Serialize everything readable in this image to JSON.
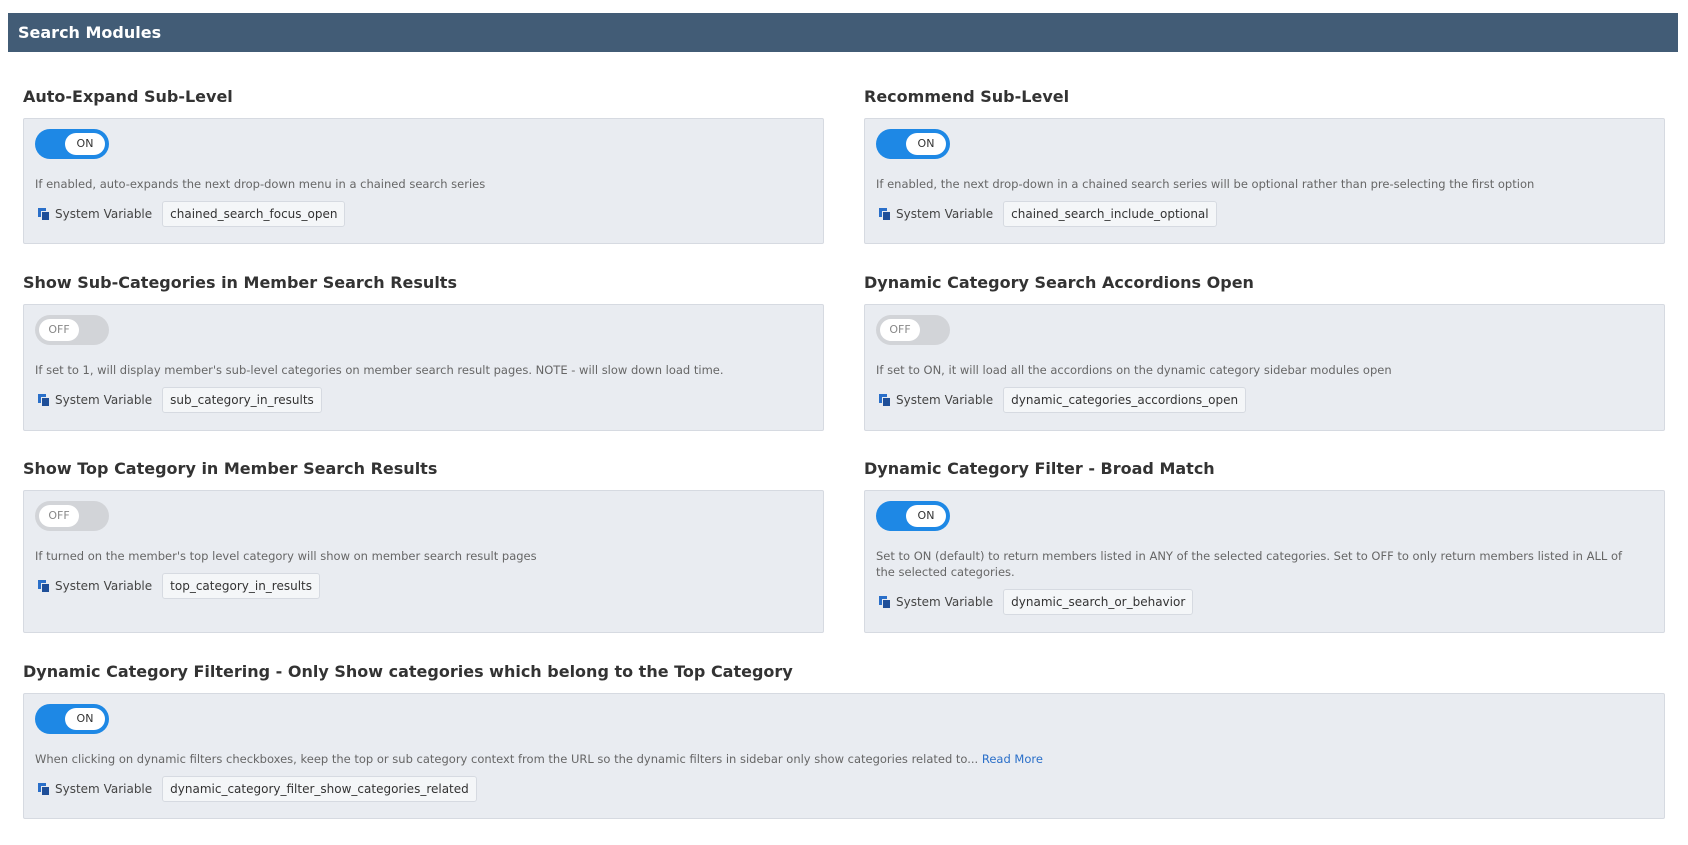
{
  "header": {
    "title": "Search Modules"
  },
  "sysvar_label": "System Variable",
  "settings": [
    {
      "title": "Auto-Expand Sub-Level",
      "toggle": "ON",
      "description": "If enabled, auto-expands the next drop-down menu in a chained search series",
      "variable": "chained_search_focus_open"
    },
    {
      "title": "Recommend Sub-Level",
      "toggle": "ON",
      "description": "If enabled, the next drop-down in a chained search series will be optional rather than pre-selecting the first option",
      "variable": "chained_search_include_optional"
    },
    {
      "title": "Show Sub-Categories in Member Search Results",
      "toggle": "OFF",
      "description": "If set to 1, will display member's sub-level categories on member search result pages. NOTE - will slow down load time.",
      "variable": "sub_category_in_results"
    },
    {
      "title": "Dynamic Category Search Accordions Open",
      "toggle": "OFF",
      "description": "If set to ON, it will load all the accordions on the dynamic category sidebar modules open",
      "variable": "dynamic_categories_accordions_open"
    },
    {
      "title": "Show Top Category in Member Search Results",
      "toggle": "OFF",
      "description": "If turned on the member's top level category will show on member search result pages",
      "variable": "top_category_in_results"
    },
    {
      "title": "Dynamic Category Filter - Broad Match",
      "toggle": "ON",
      "description": "Set to ON (default) to return members listed in ANY of the selected categories. Set to OFF to only return members listed in ALL of the selected categories.",
      "variable": "dynamic_search_or_behavior"
    },
    {
      "title": "Dynamic Category Filtering - Only Show categories which belong to the Top Category",
      "toggle": "ON",
      "description": "When clicking on dynamic filters checkboxes, keep the top or sub category context from the URL so the dynamic filters in sidebar only show categories related to...",
      "read_more": "Read More",
      "variable": "dynamic_category_filter_show_categories_related"
    }
  ],
  "colors": {
    "header_bg": "#425c76",
    "toggle_on": "#1e88e5",
    "toggle_off": "#d2d4d8",
    "card_bg": "#e9ecf1",
    "link": "#2a6fc9"
  },
  "icons": {
    "copy": "copy-icon"
  }
}
